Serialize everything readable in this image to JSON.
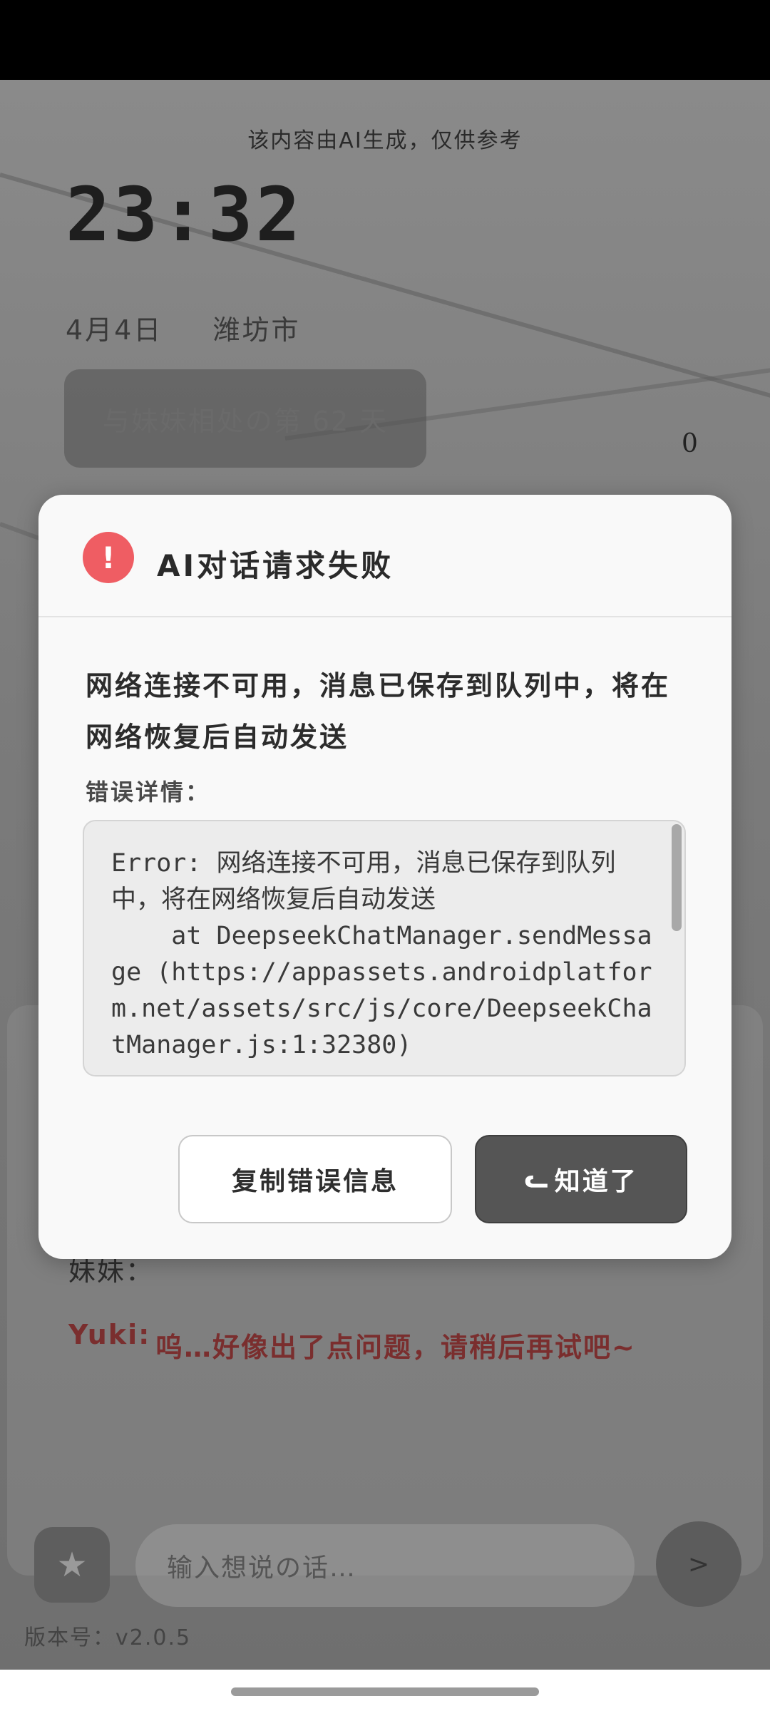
{
  "background": {
    "ai_notice": "该内容由AI生成，仅供参考",
    "clock": "23:32",
    "date": "4月4日",
    "city": "潍坊市",
    "days_together": "与妹妹相处の第 62 天",
    "counter": "0",
    "chat": {
      "user_name": "妹妹：",
      "yuki_name": "Yuki:",
      "yuki_message": "呜…好像出了点问题，请稍后再试吧~"
    },
    "input_placeholder": "输入想说の话…",
    "send_label": ">",
    "version": "版本号：v2.0.5"
  },
  "dialog": {
    "icon": "alert-icon",
    "icon_glyph": "!",
    "title": "AI对话请求失败",
    "message": "网络连接不可用，消息已保存到队列中，将在网络恢复后自动发送",
    "detail_label": "错误详情：",
    "error_detail": "Error: 网络连接不可用，消息已保存到队列中，将在网络恢复后自动发送\n    at DeepseekChatManager.sendMessage (https://appassets.androidplatform.net/assets/src/js/core/DeepseekChatManager.js:1:32380)",
    "copy_button": "复制错误信息",
    "ok_button": "知道了"
  },
  "colors": {
    "alert_red": "#ef5d63",
    "primary_dark": "#555555",
    "dialog_bg": "#f9f9f9"
  }
}
